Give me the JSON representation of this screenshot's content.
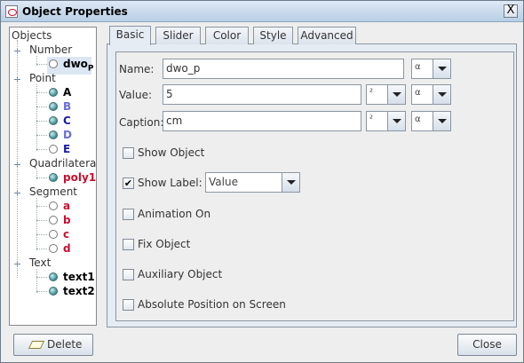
{
  "window": {
    "title": "Object Properties",
    "close_glyph": "X"
  },
  "tree": {
    "root": "Objects",
    "groups": [
      {
        "label": "Number",
        "items": [
          {
            "label": "dwo",
            "sub": "P",
            "color": "#000000",
            "icon": "hollow-circle",
            "selected": true
          }
        ]
      },
      {
        "label": "Point",
        "items": [
          {
            "label": "A",
            "color": "#000000",
            "icon": "filled-ball"
          },
          {
            "label": "B",
            "color": "#6b6bd9",
            "icon": "filled-ball"
          },
          {
            "label": "C",
            "color": "#1a1aa6",
            "icon": "filled-ball"
          },
          {
            "label": "D",
            "color": "#6b6bd9",
            "icon": "filled-ball"
          },
          {
            "label": "E",
            "color": "#1a1aa6",
            "icon": "hollow-circle"
          }
        ]
      },
      {
        "label": "Quadrilateral",
        "items": [
          {
            "label": "poly1",
            "color": "#c8102e",
            "icon": "filled-ball"
          }
        ]
      },
      {
        "label": "Segment",
        "items": [
          {
            "label": "a",
            "color": "#c8102e",
            "icon": "hollow-circle"
          },
          {
            "label": "b",
            "color": "#c8102e",
            "icon": "hollow-circle"
          },
          {
            "label": "c",
            "color": "#c8102e",
            "icon": "hollow-circle"
          },
          {
            "label": "d",
            "color": "#c8102e",
            "icon": "hollow-circle"
          }
        ]
      },
      {
        "label": "Text",
        "items": [
          {
            "label": "text1",
            "color": "#000000",
            "icon": "filled-ball"
          },
          {
            "label": "text2",
            "color": "#000000",
            "icon": "filled-ball"
          }
        ]
      }
    ]
  },
  "tabs": [
    "Basic",
    "Slider",
    "Color",
    "Style",
    "Advanced"
  ],
  "active_tab": "Basic",
  "form": {
    "name_label": "Name:",
    "name_value": "dwo_p",
    "value_label": "Value:",
    "value_value": "5",
    "caption_label": "Caption:",
    "caption_value": "cm",
    "alpha_symbol": "α",
    "superscript_symbol": "²"
  },
  "checkboxes": [
    {
      "label": "Show Object",
      "checked": false
    },
    {
      "label": "Show Label:",
      "checked": true
    },
    {
      "label": "Animation On",
      "checked": false
    },
    {
      "label": "Fix Object",
      "checked": false
    },
    {
      "label": "Auxiliary Object",
      "checked": false
    },
    {
      "label": "Absolute Position on Screen",
      "checked": false
    }
  ],
  "label_mode": {
    "selected": "Value"
  },
  "buttons": {
    "delete": "Delete",
    "close": "Close"
  },
  "check_glyph": "✔"
}
